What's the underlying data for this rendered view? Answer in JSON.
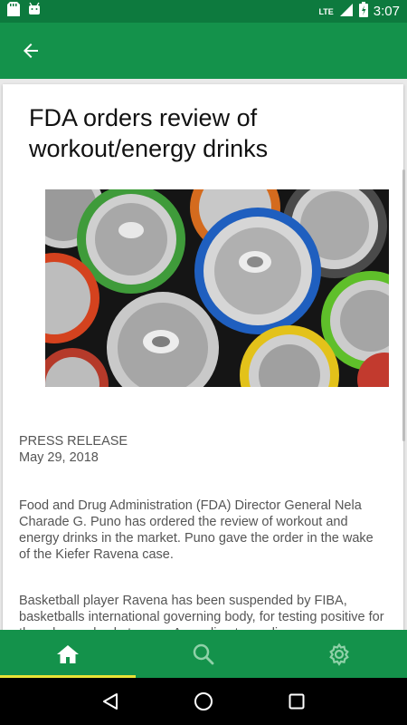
{
  "status_bar": {
    "time": "3:07",
    "network_label": "LTE",
    "icons": [
      "sd-card-icon",
      "android-icon",
      "signal-icon",
      "battery-icon"
    ]
  },
  "app_bar": {
    "back_icon": "arrow-back-icon"
  },
  "article": {
    "title": "FDA orders review of workout/energy drinks",
    "image_alt": "Top-down view of colorful aluminum beverage cans",
    "meta_line1": "PRESS RELEASE",
    "meta_line2": "May 29, 2018",
    "paragraph1": "Food and Drug Administration (FDA) Director General Nela Charade G. Puno has ordered the review of workout and energy drinks in the market.  Puno gave the order in the wake of the Kiefer Ravena case.",
    "paragraph2": "Basketball player Ravena has  been suspended by FIBA, basketballs international governing body, for testing positive for three banned substances. According to media"
  },
  "bottom_nav": {
    "items": [
      {
        "icon": "home-icon",
        "active": true
      },
      {
        "icon": "search-icon",
        "active": false
      },
      {
        "icon": "settings-icon",
        "active": false
      }
    ]
  },
  "colors": {
    "primary": "#14924b",
    "status_bar": "#0d7a3e",
    "active_indicator": "#e8e337"
  }
}
